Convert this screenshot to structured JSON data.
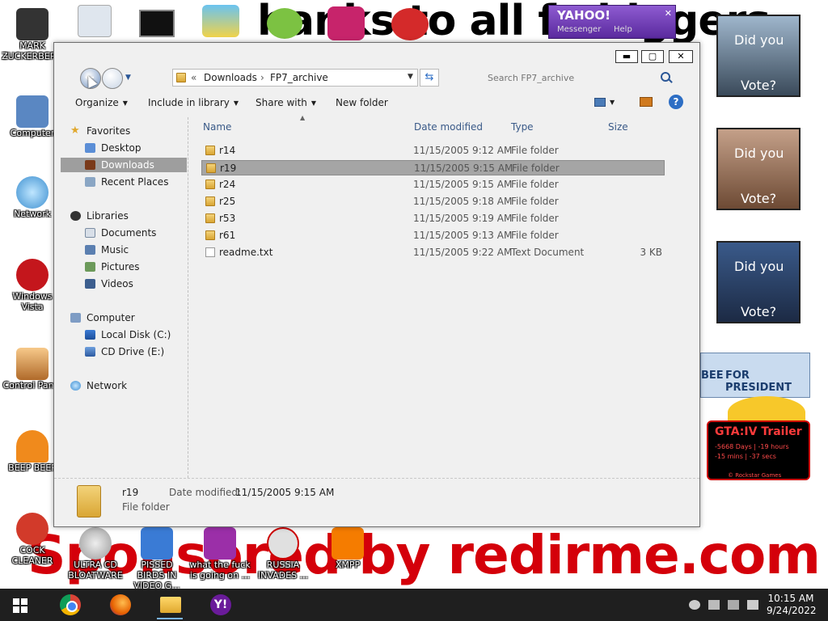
{
  "desktop": {
    "banner_top": "hanks to all fa     higgers",
    "banner_bottom": "Sponsored by redirme.com",
    "icons": [
      {
        "label": "MARK ZUCKERBERG"
      },
      {
        "label": "Computer"
      },
      {
        "label": "Network"
      },
      {
        "label": "Windows Vista"
      },
      {
        "label": "Control Panel"
      },
      {
        "label": "BEEP BEEP"
      },
      {
        "label": "COCK CLEANER"
      },
      {
        "label": "ULTRA CD BLOATWARE"
      },
      {
        "label": "PISSED BIRDS IN VIDEO G..."
      },
      {
        "label": "what the fuck is going on ..."
      },
      {
        "label": "RUSSIA INVADES ..."
      },
      {
        "label": "XMPP"
      }
    ],
    "yahoo_widget": {
      "title": "YAHOO!",
      "menu1": "Messenger",
      "menu2": "Help"
    },
    "vote_text": [
      "Did you",
      "Vote?"
    ],
    "bee_banner": "FOR PRESIDENT",
    "bee_prefix": "BEE",
    "gta_widget": {
      "title": "GTA:IV Trailer",
      "line1": "-5668 Days | -19 hours",
      "line2": "-15 mins | -37 secs",
      "footer": "© Rockstar Games"
    }
  },
  "window": {
    "controls": {
      "minimize": "▬",
      "maximize": "▢",
      "close": "✕"
    },
    "address": {
      "sep": "«",
      "crumb1": "Downloads",
      "crumb2": "FP7_archive",
      "sep2": "›"
    },
    "search": {
      "placeholder": "Search FP7_archive"
    },
    "toolbar": {
      "organize": "Organize",
      "include": "Include in library",
      "share": "Share with",
      "new_folder": "New folder"
    },
    "nav": {
      "favorites": "Favorites",
      "desktop": "Desktop",
      "downloads": "Downloads",
      "recent": "Recent Places",
      "libraries": "Libraries",
      "documents": "Documents",
      "music": "Music",
      "pictures": "Pictures",
      "videos": "Videos",
      "computer": "Computer",
      "local_disk": "Local Disk (C:)",
      "cd_drive": "CD Drive (E:)",
      "network": "Network"
    },
    "columns": {
      "name": "Name",
      "date": "Date modified",
      "type": "Type",
      "size": "Size"
    },
    "files": [
      {
        "name": "r14",
        "date": "11/15/2005 9:12 AM",
        "type": "File folder",
        "size": ""
      },
      {
        "name": "r19",
        "date": "11/15/2005 9:15 AM",
        "type": "File folder",
        "size": ""
      },
      {
        "name": "r24",
        "date": "11/15/2005 9:15 AM",
        "type": "File folder",
        "size": ""
      },
      {
        "name": "r25",
        "date": "11/15/2005 9:18 AM",
        "type": "File folder",
        "size": ""
      },
      {
        "name": "r53",
        "date": "11/15/2005 9:19 AM",
        "type": "File folder",
        "size": ""
      },
      {
        "name": "r61",
        "date": "11/15/2005 9:13 AM",
        "type": "File folder",
        "size": ""
      },
      {
        "name": "readme.txt",
        "date": "11/15/2005 9:22 AM",
        "type": "Text Document",
        "size": "3 KB"
      }
    ],
    "details": {
      "name": "r19",
      "date_label": "Date modified:",
      "date": "11/15/2005 9:15 AM",
      "type": "File folder"
    }
  },
  "taskbar": {
    "time": "10:15 AM",
    "date": "9/24/2022",
    "yahoo_glyph": "Y!"
  },
  "colors": {
    "selection": "#a5a5a5",
    "nav_selection": "#9e9e9e",
    "taskbar": "#1f1f1f",
    "banner_red": "#d4000a"
  }
}
